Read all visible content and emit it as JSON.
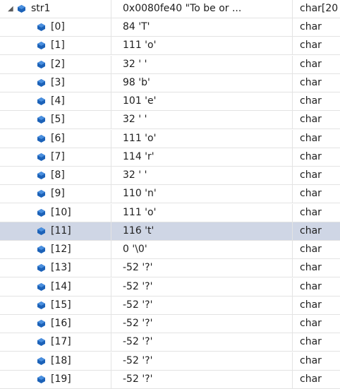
{
  "parent": {
    "expander_glyph": "◢",
    "name": "str1",
    "value": "0x0080fe40 \"To be or ...",
    "type": "char[20"
  },
  "rows": [
    {
      "name": "[0]",
      "value": "84 'T'",
      "type": "char"
    },
    {
      "name": "[1]",
      "value": "111 'o'",
      "type": "char"
    },
    {
      "name": "[2]",
      "value": "32 ' '",
      "type": "char"
    },
    {
      "name": "[3]",
      "value": "98 'b'",
      "type": "char"
    },
    {
      "name": "[4]",
      "value": "101 'e'",
      "type": "char"
    },
    {
      "name": "[5]",
      "value": "32 ' '",
      "type": "char"
    },
    {
      "name": "[6]",
      "value": "111 'o'",
      "type": "char"
    },
    {
      "name": "[7]",
      "value": "114 'r'",
      "type": "char"
    },
    {
      "name": "[8]",
      "value": "32 ' '",
      "type": "char"
    },
    {
      "name": "[9]",
      "value": "110 'n'",
      "type": "char"
    },
    {
      "name": "[10]",
      "value": "111 'o'",
      "type": "char"
    },
    {
      "name": "[11]",
      "value": "116 't'",
      "type": "char",
      "selected": true
    },
    {
      "name": "[12]",
      "value": "0 '\\0'",
      "type": "char"
    },
    {
      "name": "[13]",
      "value": "-52 '?'",
      "type": "char"
    },
    {
      "name": "[14]",
      "value": "-52 '?'",
      "type": "char"
    },
    {
      "name": "[15]",
      "value": "-52 '?'",
      "type": "char"
    },
    {
      "name": "[16]",
      "value": "-52 '?'",
      "type": "char"
    },
    {
      "name": "[17]",
      "value": "-52 '?'",
      "type": "char"
    },
    {
      "name": "[18]",
      "value": "-52 '?'",
      "type": "char"
    },
    {
      "name": "[19]",
      "value": "-52 '?'",
      "type": "char"
    }
  ],
  "icons": {
    "object": "object-member-icon",
    "visualizer": "magnifier-icon",
    "visualizer_menu": "dropdown-arrow-icon"
  },
  "colors": {
    "selected_row": "#cfd6e5",
    "icon_blue": "#1c62b8",
    "grid_line": "#e3e3e3"
  }
}
